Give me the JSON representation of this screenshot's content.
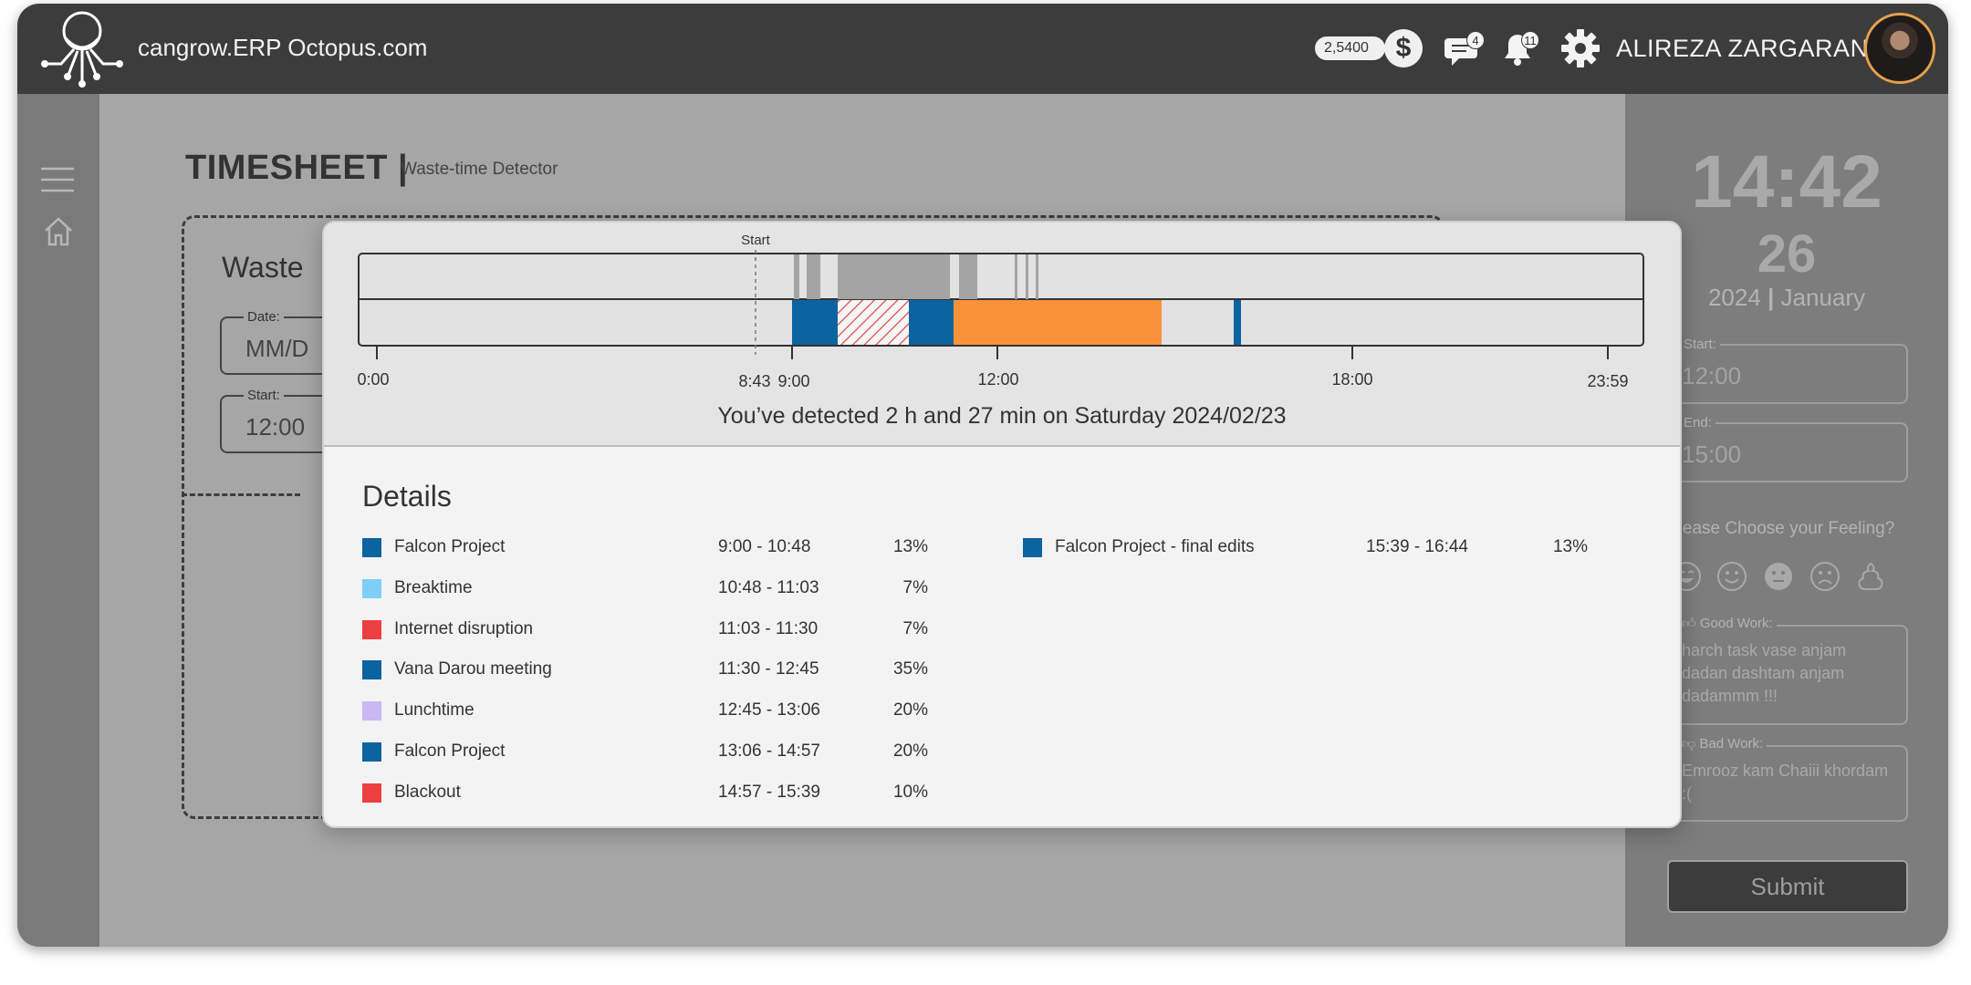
{
  "header": {
    "app_title": "cangrow.ERP Octopus.com",
    "coins": "2,5400",
    "messages_count": "4",
    "notifications_count": "11",
    "user_name": "ALIREZA ZARGARANI",
    "icons": [
      "octopus-logo",
      "dollar-icon",
      "chat-icon",
      "bell-icon",
      "gear-icon",
      "avatar"
    ]
  },
  "sidebar": {
    "icons": [
      "menu-icon",
      "home-icon"
    ]
  },
  "page": {
    "title": "TIMESHEET |",
    "subtitle": "Waste-time Detector",
    "background_heading": "Waste",
    "date_field": {
      "label": "Date:",
      "value": "MM/D"
    },
    "start_field": {
      "label": "Start:",
      "value": "12:00"
    }
  },
  "right_panel": {
    "time": "14:42",
    "seconds": "26",
    "year": "2024",
    "month": "January",
    "start": {
      "label": "Start:",
      "value": "12:00"
    },
    "end": {
      "label": "End:",
      "value": "15:00"
    },
    "feeling_prompt": "Please Choose your Feeling?",
    "feelings": [
      "very-happy-icon",
      "happy-icon",
      "neutral-icon",
      "sad-icon",
      "poop-icon"
    ],
    "good_work": {
      "label": "Good Work:",
      "text": "harch task vase anjam dadan dashtam anjam dadammm !!!"
    },
    "bad_work": {
      "label": "Bad Work:",
      "text": "Emrooz kam Chaiii khordam :("
    },
    "submit_label": "Submit"
  },
  "modal": {
    "start_marker_label": "Start",
    "axis_labels": [
      "0:00",
      "8:43",
      "9:00",
      "12:00",
      "18:00",
      "23:59"
    ],
    "detected_text": "You’ve detected 2 h and 27 min on Saturday 2024/02/23",
    "details_title": "Details",
    "colors": {
      "blue": "#0b64a0",
      "light_blue": "#7ecff5",
      "red": "#ec4040",
      "lavender": "#c9b8f2",
      "orange": "#f7923b",
      "gray_block": "#a4a4a4"
    },
    "details": [
      {
        "name": "Falcon Project",
        "time": "9:00 - 10:48",
        "percent": "13%",
        "color": "#0b64a0"
      },
      {
        "name": "Breaktime",
        "time": "10:48 - 11:03",
        "percent": "7%",
        "color": "#7ecff5"
      },
      {
        "name": "Internet disruption",
        "time": "11:03 - 11:30",
        "percent": "7%",
        "color": "#ec4040"
      },
      {
        "name": "Vana Darou meeting",
        "time": "11:30 - 12:45",
        "percent": "35%",
        "color": "#0b64a0"
      },
      {
        "name": "Lunchtime",
        "time": "12:45 - 13:06",
        "percent": "20%",
        "color": "#c9b8f2"
      },
      {
        "name": "Falcon Project",
        "time": "13:06 - 14:57",
        "percent": "20%",
        "color": "#0b64a0"
      },
      {
        "name": "Blackout",
        "time": "14:57 - 15:39",
        "percent": "10%",
        "color": "#ec4040"
      },
      {
        "name": "Falcon Project - final edits",
        "time": "15:39 - 16:44",
        "percent": "13%",
        "color": "#0b64a0"
      }
    ]
  }
}
